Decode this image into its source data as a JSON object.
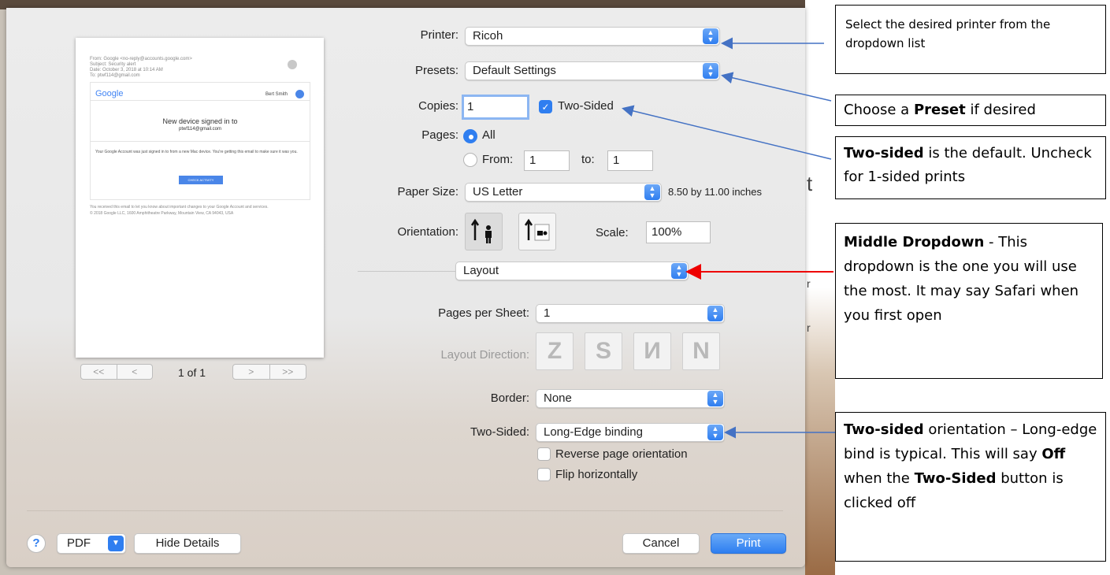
{
  "dialog": {
    "printer": {
      "label": "Printer:",
      "value": "Ricoh"
    },
    "presets": {
      "label": "Presets:",
      "value": "Default Settings"
    },
    "copies": {
      "label": "Copies:",
      "value": "1",
      "two_sided_label": "Two-Sided",
      "two_sided_checked": true
    },
    "pages": {
      "label": "Pages:",
      "all_label": "All",
      "from_label": "From:",
      "from_value": "1",
      "to_label": "to:",
      "to_value": "1"
    },
    "paper_size": {
      "label": "Paper Size:",
      "value": "US Letter",
      "dimensions": "8.50 by 11.00 inches"
    },
    "orientation": {
      "label": "Orientation:",
      "selected": "portrait"
    },
    "scale": {
      "label": "Scale:",
      "value": "100%"
    },
    "section_popup": "Layout",
    "pages_per_sheet": {
      "label": "Pages per Sheet:",
      "value": "1"
    },
    "layout_direction": {
      "label": "Layout Direction:"
    },
    "border": {
      "label": "Border:",
      "value": "None"
    },
    "two_sided_binding": {
      "label": "Two-Sided:",
      "value": "Long-Edge binding"
    },
    "reverse_label": "Reverse page orientation",
    "flip_label": "Flip horizontally",
    "buttons": {
      "help": "?",
      "pdf": "PDF",
      "hide_details": "Hide Details",
      "cancel": "Cancel",
      "print": "Print"
    }
  },
  "preview": {
    "from_line": "From: Google <no-reply@accounts.google.com>",
    "subject_line": "Subject: Security alert",
    "date_line": "Date: October 3, 2018 at 10:14 AM",
    "to_line": "To: ptwf114@gmail.com",
    "logo": "Google",
    "account_name": "Bert Smith",
    "headline": "New device signed in to",
    "email": "ptwf114@gmail.com",
    "body": "Your Google Account was just signed in to from a new Mac device. You're getting this email to make sure it was you.",
    "button": "CHECK ACTIVITY",
    "footer_1": "You received this email to let you know about important changes to your Google Account and services.",
    "footer_2": "© 2018 Google LLC, 1600 Amphitheatre Parkway, Mountain View, CA 94043, USA",
    "page_indicator": "1 of 1",
    "nav_left": [
      "<<",
      "<"
    ],
    "nav_right": [
      ">",
      ">>"
    ]
  },
  "callouts": {
    "printer": {
      "text": "Select the desired printer from the dropdown list"
    },
    "preset": {
      "pre": "Choose a ",
      "bold": "Preset",
      "post": " if desired"
    },
    "two_sided": {
      "bold": "Two-sided",
      "post": " is the default. Uncheck for 1-sided prints"
    },
    "middle": {
      "bold": "Middle Dropdown",
      "post": " - This dropdown is the one you will use the most. It may say Safari when you first open"
    },
    "orientation": {
      "bold1": "Two-sided",
      "text1": " orientation – Long-edge bind is typical. This will say ",
      "bold2": "Off",
      "text2": " when the ",
      "bold3": "Two-Sided",
      "text3": " button is clicked off"
    }
  },
  "background_text": [
    "t",
    "r",
    "r"
  ],
  "colors": {
    "accent": "#2f7ef0",
    "red_arrow": "#ee0000",
    "blue_arrow": "#4472c4"
  }
}
